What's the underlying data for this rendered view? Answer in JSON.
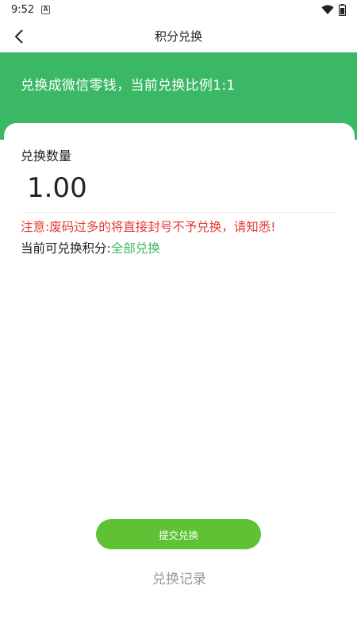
{
  "status_bar": {
    "time": "9:52",
    "notification_letter": "A"
  },
  "nav": {
    "title": "积分兑换"
  },
  "banner": {
    "text": "兑换成微信零钱，当前兑换比例1:1"
  },
  "form": {
    "quantity_label": "兑换数量",
    "quantity_value": "1.00",
    "warning": "注意:废码过多的将直接封号不予兑换，请知悉!",
    "points_label": "当前可兑换积分:",
    "all_exchange_link": "全部兑换"
  },
  "actions": {
    "submit_label": "提交兑换",
    "record_label": "兑换记录"
  },
  "colors": {
    "primary_green": "#3ab865",
    "button_green": "#5ec234",
    "warning_red": "#e53935"
  }
}
